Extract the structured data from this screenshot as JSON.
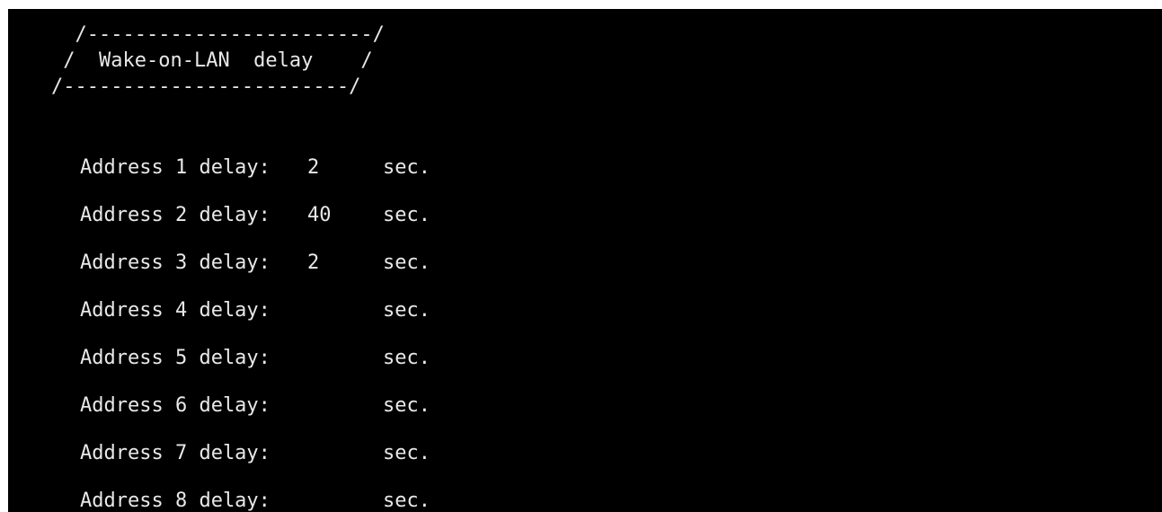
{
  "banner": {
    "line1": "/------------------------/",
    "line2_left": "/",
    "title": "Wake-on-LAN  delay",
    "line2_right": "/",
    "line3": "/------------------------/"
  },
  "rows": [
    {
      "label": "Address 1 delay:",
      "value": "2",
      "unit": "sec."
    },
    {
      "label": "Address 2 delay:",
      "value": "40",
      "unit": "sec."
    },
    {
      "label": "Address 3 delay:",
      "value": "2",
      "unit": "sec."
    },
    {
      "label": "Address 4 delay:",
      "value": "",
      "unit": "sec."
    },
    {
      "label": "Address 5 delay:",
      "value": "",
      "unit": "sec."
    },
    {
      "label": "Address 6 delay:",
      "value": "",
      "unit": "sec."
    },
    {
      "label": "Address 7 delay:",
      "value": "",
      "unit": "sec."
    },
    {
      "label": "Address 8 delay:",
      "value": "",
      "unit": "sec."
    }
  ]
}
